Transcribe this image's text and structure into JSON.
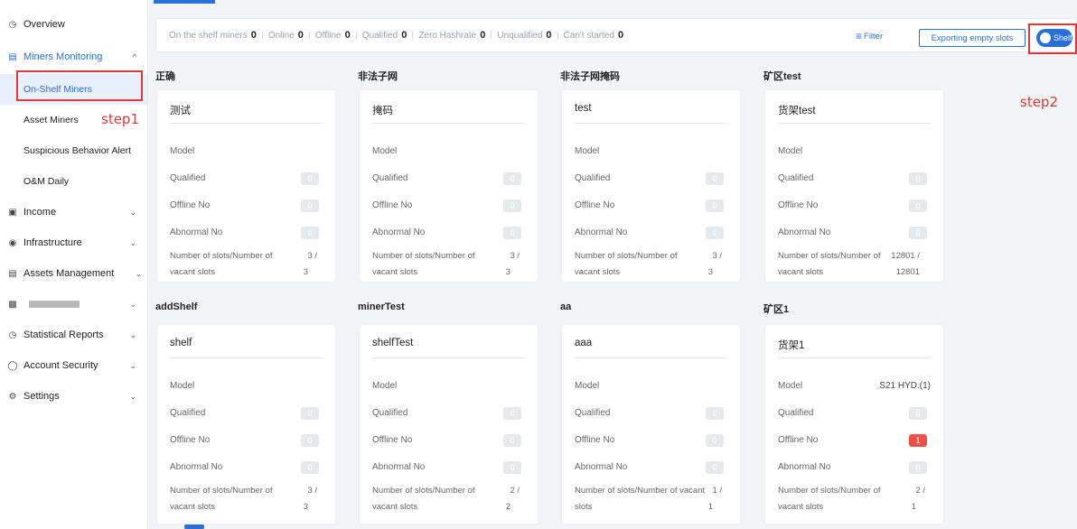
{
  "sidebar": {
    "items": [
      {
        "label": "Overview",
        "icon": "clock-icon"
      },
      {
        "label": "Miners Monitoring",
        "icon": "monitor-icon"
      },
      {
        "label": "Income",
        "icon": "income-icon"
      },
      {
        "label": "Infrastructure",
        "icon": "infrastructure-icon"
      },
      {
        "label": "Assets Management",
        "icon": "assets-icon"
      },
      {
        "label": "",
        "icon": "chart-icon"
      },
      {
        "label": "Statistical Reports",
        "icon": "reports-icon"
      },
      {
        "label": "Account Security",
        "icon": "shield-icon"
      },
      {
        "label": "Settings",
        "icon": "gear-icon"
      }
    ],
    "sub_items": [
      "On-Shelf Miners",
      "Asset Miners",
      "Suspicious Behavior Alert",
      "O&M Daily"
    ],
    "step1": "step1"
  },
  "status": {
    "items": [
      {
        "label": "On the shelf miners",
        "value": "0"
      },
      {
        "label": "Online",
        "value": "0"
      },
      {
        "label": "Offline",
        "value": "0"
      },
      {
        "label": "Qualified",
        "value": "0"
      },
      {
        "label": "Zero Hashrate",
        "value": "0"
      },
      {
        "label": "Unqualified",
        "value": "0"
      },
      {
        "label": "Can't started",
        "value": "0"
      }
    ],
    "filter_label": "Filter",
    "export_label": "Exporting empty slots",
    "toggle_label": "Shelf",
    "step2": "step2"
  },
  "labels": {
    "model": "Model",
    "qualified": "Qualified",
    "offline": "Offline No",
    "abnormal": "Abnormal No",
    "slots_a": "Number of slots/Number of",
    "slots_b": "vacant slots"
  },
  "groups": [
    {
      "title": "正确",
      "card": {
        "name": "测试",
        "model": "",
        "qualified": "0",
        "offline": "0",
        "abnormal": "0",
        "slots_l1": "Number of slots/Number of",
        "slots_l2": "vacant slots",
        "slots": "3 /",
        "vacant": "3"
      }
    },
    {
      "title": "非法子网",
      "card": {
        "name": "掩码",
        "model": "",
        "qualified": "0",
        "offline": "0",
        "abnormal": "0",
        "slots_l1": "Number of slots/Number of",
        "slots_l2": "vacant slots",
        "slots": "3 /",
        "vacant": "3"
      }
    },
    {
      "title": "非法子网掩码",
      "card": {
        "name": "test",
        "model": "",
        "qualified": "0",
        "offline": "0",
        "abnormal": "0",
        "slots_l1": "Number of slots/Number of",
        "slots_l2": "vacant slots",
        "slots": "3 /",
        "vacant": "3"
      }
    },
    {
      "title": "矿区test",
      "card": {
        "name": "货架test",
        "model": "",
        "qualified": "0",
        "offline": "0",
        "abnormal": "0",
        "slots_l1": "Number of slots/Number of",
        "slots_l2": "vacant slots",
        "slots": "12801 /",
        "vacant": "12801"
      }
    },
    {
      "title": "addShelf",
      "card": {
        "name": "shelf",
        "model": "",
        "qualified": "0",
        "offline": "0",
        "abnormal": "0",
        "slots_l1": "Number of slots/Number of",
        "slots_l2": "vacant slots",
        "slots": "3 /",
        "vacant": "3"
      }
    },
    {
      "title": "minerTest",
      "card": {
        "name": "shelfTest",
        "model": "",
        "qualified": "0",
        "offline": "0",
        "abnormal": "0",
        "slots_l1": "Number of slots/Number of",
        "slots_l2": "vacant slots",
        "slots": "2 /",
        "vacant": "2"
      }
    },
    {
      "title": "aa",
      "card": {
        "name": "aaa",
        "model": "",
        "qualified": "0",
        "offline": "0",
        "abnormal": "0",
        "slots_l1": "Number of slots/Number of vacant",
        "slots_l2": "slots",
        "slots": "1 /",
        "vacant": "1"
      }
    },
    {
      "title": "矿区1",
      "card": {
        "name": "货架1",
        "model": "S21 HYD.(1)",
        "qualified": "0",
        "offline": "1",
        "abnormal": "0",
        "slots_l1": "Number of slots/Number of",
        "slots_l2": "vacant slots",
        "slots": "2 /",
        "vacant": "1"
      }
    }
  ],
  "colors": {
    "accent": "#2a6fd6",
    "alert": "#f0504a",
    "annotation": "#d93a3a"
  }
}
